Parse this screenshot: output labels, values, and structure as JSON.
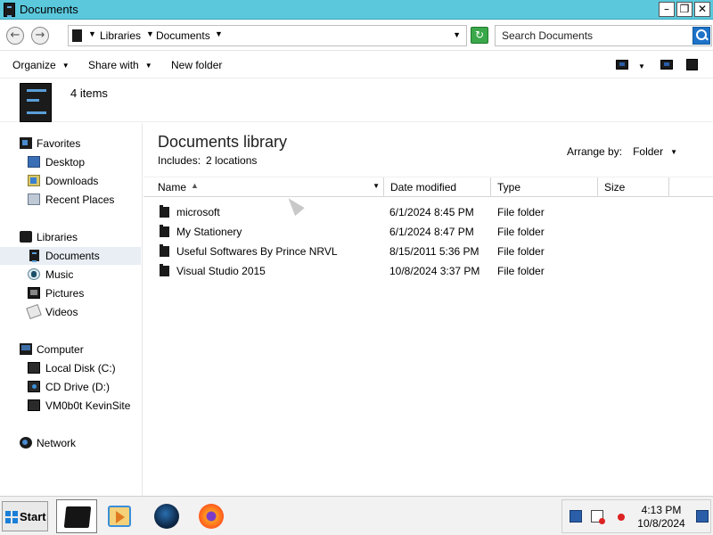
{
  "window": {
    "title": "Documents",
    "controls": [
      "minimize",
      "restore",
      "close"
    ]
  },
  "address_bar": {
    "breadcrumbs": [
      "Libraries",
      "Documents"
    ],
    "search_placeholder": "Search Documents"
  },
  "command_bar": {
    "organize_label": "Organize",
    "share_with_label": "Share with",
    "new_folder_label": "New folder"
  },
  "details": {
    "item_count": "4 items"
  },
  "nav_pane": {
    "favorites": {
      "label": "Favorites",
      "items": [
        {
          "label": "Desktop",
          "icon": "desktop-icon"
        },
        {
          "label": "Downloads",
          "icon": "downloads-icon"
        },
        {
          "label": "Recent Places",
          "icon": "recent-places-icon"
        }
      ]
    },
    "libraries": {
      "label": "Libraries",
      "items": [
        {
          "label": "Documents",
          "icon": "documents-icon",
          "selected": true
        },
        {
          "label": "Music",
          "icon": "music-icon"
        },
        {
          "label": "Pictures",
          "icon": "pictures-icon"
        },
        {
          "label": "Videos",
          "icon": "videos-icon"
        }
      ]
    },
    "computer": {
      "label": "Computer",
      "items": [
        {
          "label": "Local Disk (C:)",
          "icon": "hard-disk-icon"
        },
        {
          "label": "CD Drive (D:)",
          "icon": "cd-drive-icon"
        },
        {
          "label": "VM0b0t KevinSite",
          "icon": "network-drive-icon"
        }
      ]
    },
    "network": {
      "label": "Network"
    }
  },
  "library": {
    "title": "Documents library",
    "includes_label": "Includes:",
    "locations_link": "2 locations",
    "arrange_by_label": "Arrange by:",
    "arrange_by_value": "Folder"
  },
  "columns": {
    "name": "Name",
    "date_modified": "Date modified",
    "type": "Type",
    "size": "Size"
  },
  "files": [
    {
      "name": "microsoft",
      "date_modified": "6/1/2024 8:45 PM",
      "type": "File folder",
      "size": ""
    },
    {
      "name": "My Stationery",
      "date_modified": "6/1/2024 8:47 PM",
      "type": "File folder",
      "size": ""
    },
    {
      "name": "Useful Softwares By Prince NRVL",
      "date_modified": "8/15/2011 5:36 PM",
      "type": "File folder",
      "size": ""
    },
    {
      "name": "Visual Studio 2015",
      "date_modified": "10/8/2024 3:37 PM",
      "type": "File folder",
      "size": ""
    }
  ],
  "taskbar": {
    "start_label": "Start",
    "apps": [
      "file-explorer-icon",
      "media-player-icon",
      "globe-browser-icon",
      "firefox-icon"
    ],
    "clock_time": "4:13 PM",
    "clock_date": "10/8/2024"
  },
  "colors": {
    "titlebar": "#5bc8dc",
    "selection": "#e8eef4",
    "search_button": "#1e73c8",
    "refresh_button": "#3aa84a"
  }
}
